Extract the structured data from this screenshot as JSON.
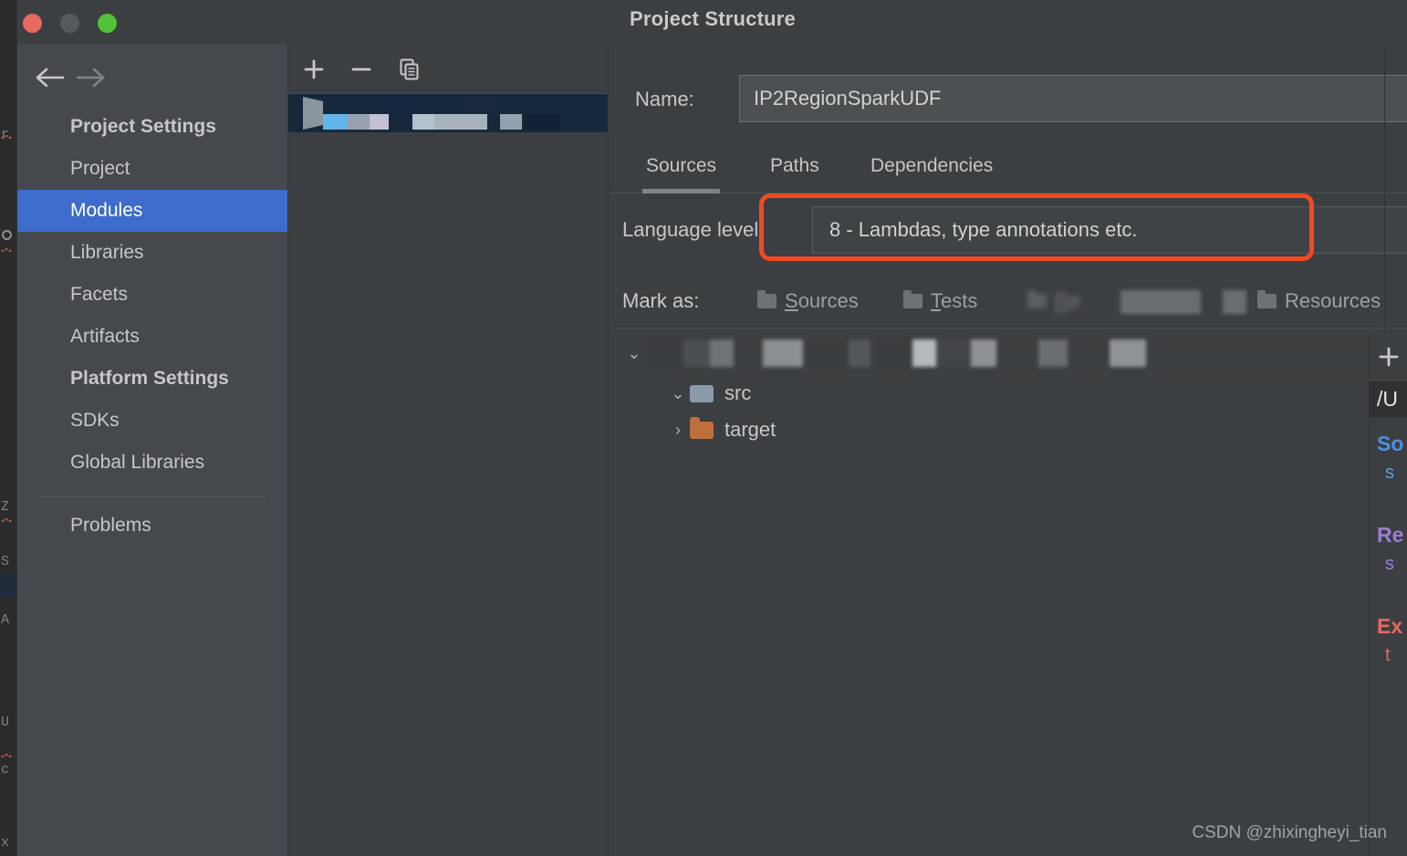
{
  "window": {
    "title": "Project Structure",
    "traffic_lights": [
      "close-button",
      "minimize-button",
      "maximize-button"
    ]
  },
  "nav": {
    "back_icon": "arrow-left-icon",
    "forward_icon": "arrow-right-icon"
  },
  "sidebar": {
    "groups": [
      {
        "label": "Project Settings",
        "items": [
          {
            "label": "Project",
            "selected": false
          },
          {
            "label": "Modules",
            "selected": true
          },
          {
            "label": "Libraries",
            "selected": false
          },
          {
            "label": "Facets",
            "selected": false
          },
          {
            "label": "Artifacts",
            "selected": false
          }
        ]
      },
      {
        "label": "Platform Settings",
        "items": [
          {
            "label": "SDKs",
            "selected": false
          },
          {
            "label": "Global Libraries",
            "selected": false
          }
        ]
      }
    ],
    "footer_items": [
      {
        "label": "Problems",
        "selected": false
      }
    ]
  },
  "module_list": {
    "toolbar": [
      {
        "name": "add-module-button",
        "icon": "plus-icon"
      },
      {
        "name": "remove-module-button",
        "icon": "minus-icon"
      },
      {
        "name": "copy-module-button",
        "icon": "copy-icon"
      }
    ],
    "selected_row_label": ""
  },
  "detail": {
    "name_label": "Name:",
    "name_value": "IP2RegionSparkUDF",
    "name_placeholder": "",
    "tabs": [
      {
        "label": "Sources",
        "active": true
      },
      {
        "label": "Paths",
        "active": false
      },
      {
        "label": "Dependencies",
        "active": false
      }
    ],
    "language_level": {
      "label": "Language level:",
      "value": "8 - Lambdas, type annotations etc.",
      "highlight_color": "#f04a23"
    },
    "mark_as": {
      "label": "Mark as:",
      "items": [
        {
          "mnemonic": "S",
          "rest": "ources",
          "blurred": false
        },
        {
          "mnemonic": "T",
          "rest": "ests",
          "blurred": false
        },
        {
          "mnemonic": "R",
          "rest": "e",
          "blurred": true
        },
        {
          "mnemonic": "",
          "rest": "Resources",
          "blurred": false
        }
      ]
    },
    "tree": [
      {
        "label": "",
        "indent": 0,
        "expanded": true,
        "icon": "none",
        "blurred": true
      },
      {
        "label": "src",
        "indent": 1,
        "expanded": true,
        "icon": "folder-blue",
        "blurred": false
      },
      {
        "label": "target",
        "indent": 1,
        "expanded": false,
        "icon": "folder-orange",
        "blurred": false
      }
    ]
  },
  "right_panel": {
    "add_icon": "plus-icon",
    "path_text": "/U",
    "entries": [
      {
        "title": "So",
        "sub": "s",
        "color": "#4a90e2"
      },
      {
        "title": "Re",
        "sub": "s",
        "color": "#9b7fd4"
      },
      {
        "title": "Ex",
        "sub": "t",
        "color": "#e8685e"
      }
    ]
  },
  "watermark": "CSDN @zhixingheyi_tian",
  "editor_sliver": {
    "fragments": [
      "r",
      "Z",
      "S",
      "A",
      "U",
      "c",
      "x"
    ]
  }
}
